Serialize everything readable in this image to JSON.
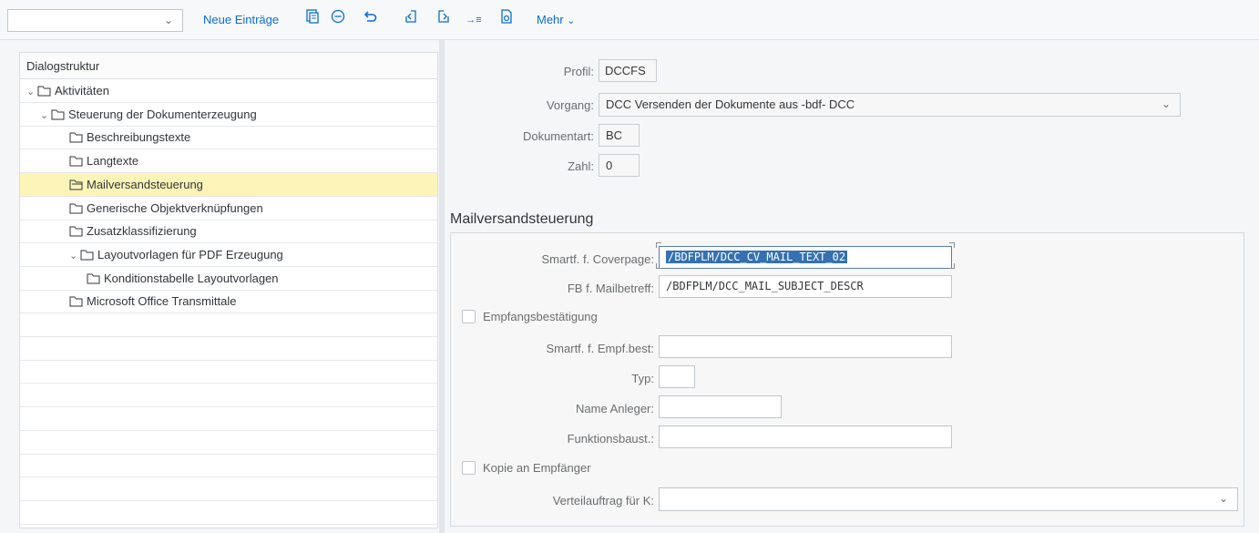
{
  "toolbar": {
    "select_value": "",
    "new_entries_label": "Neue Einträge",
    "more_label": "Mehr",
    "icons": [
      "copy-icon",
      "delete-icon",
      "undo-icon",
      "previous-entry-icon",
      "next-entry-icon",
      "goto-icon",
      "select-icon"
    ]
  },
  "tree": {
    "header": "Dialogstruktur",
    "items": [
      {
        "label": "Aktivitäten",
        "level": 0,
        "expanded": true
      },
      {
        "label": "Steuerung der Dokumenterzeugung",
        "level": 1,
        "expanded": true
      },
      {
        "label": "Beschreibungstexte",
        "level": 2
      },
      {
        "label": "Langtexte",
        "level": 2
      },
      {
        "label": "Mailversandsteuerung",
        "level": 2,
        "selected": true
      },
      {
        "label": "Generische Objektverknüpfungen",
        "level": 2
      },
      {
        "label": "Zusatzklassifizierung",
        "level": 2
      },
      {
        "label": "Layoutvorlagen für PDF Erzeugung",
        "level": 2,
        "expanded": true
      },
      {
        "label": "Konditionstabelle Layoutvorlagen",
        "level": 3
      },
      {
        "label": "Microsoft Office Transmittale",
        "level": 2
      }
    ]
  },
  "header_fields": {
    "profil_label": "Profil:",
    "profil_value": "DCCFS",
    "vorgang_label": "Vorgang:",
    "vorgang_value": "DCC Versenden der Dokumente aus -bdf- DCC",
    "dokumentart_label": "Dokumentart:",
    "dokumentart_value": "BC",
    "zahl_label": "Zahl:",
    "zahl_value": "0"
  },
  "section": {
    "title": "Mailversandsteuerung",
    "coverpage_label": "Smartf. f. Coverpage:",
    "coverpage_value": "/BDFPLM/DCC_CV_MAIL_TEXT_02",
    "mailbetreff_label": "FB f. Mailbetreff:",
    "mailbetreff_value": "/BDFPLM/DCC_MAIL_SUBJECT_DESCR",
    "empfangsbestaetigung_label": "Empfangsbestätigung",
    "empfangsbestaetigung_checked": false,
    "empf_best_label": "Smartf. f. Empf.best:",
    "empf_best_value": "",
    "typ_label": "Typ:",
    "typ_value": "",
    "name_anleger_label": "Name Anleger:",
    "name_anleger_value": "",
    "funktionsbaust_label": "Funktionsbaust.:",
    "funktionsbaust_value": "",
    "kopie_label": "Kopie an Empfänger",
    "kopie_checked": false,
    "verteilauftrag_label": "Verteilauftrag für K:",
    "verteilauftrag_value": ""
  },
  "colors": {
    "accent": "#0a6ed1",
    "selection": "#fdf5b8",
    "highlight": "#3471b4"
  }
}
